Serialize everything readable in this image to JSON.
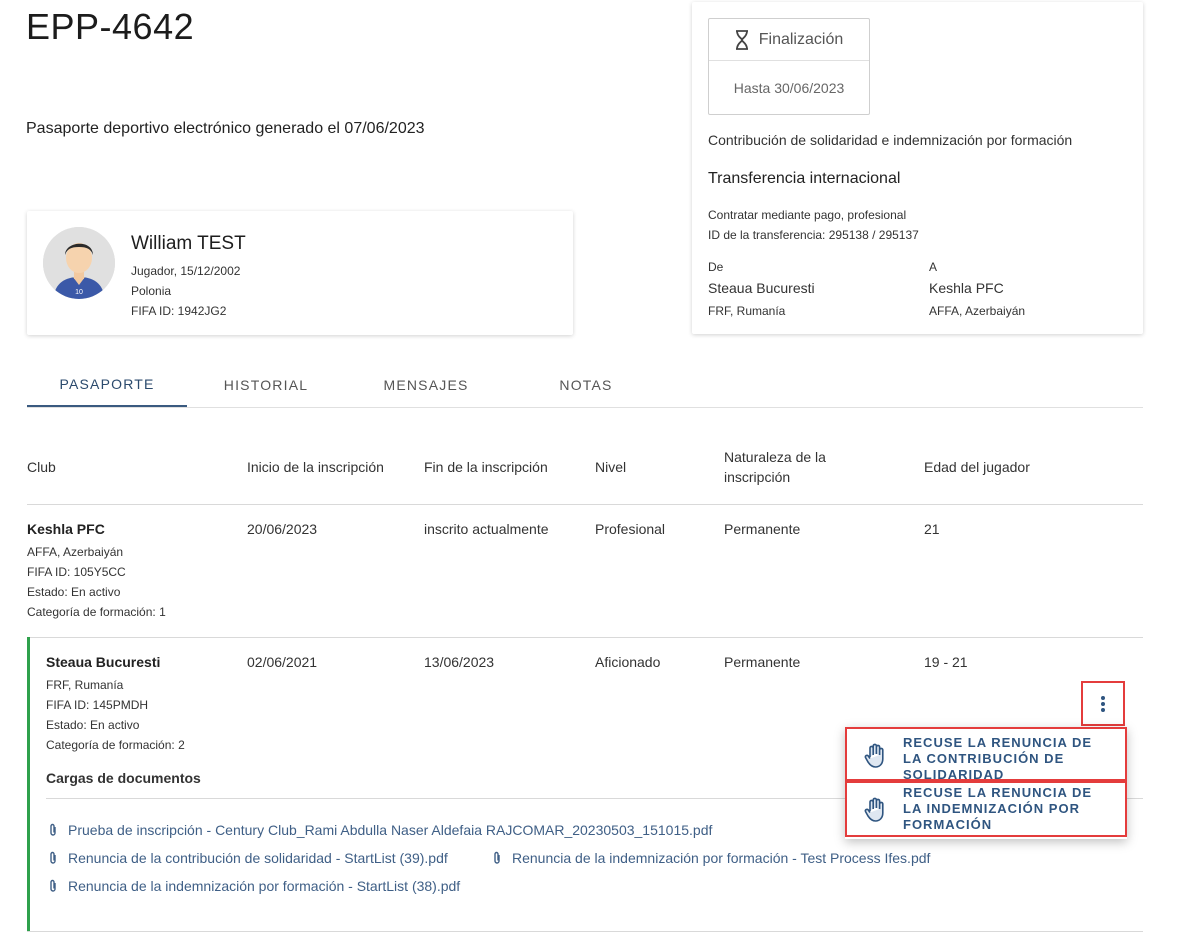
{
  "header": {
    "title": "EPP-4642",
    "subtitle": "Pasaporte deportivo electrónico generado el 07/06/2023"
  },
  "player": {
    "name": "William TEST",
    "line1": "Jugador, 15/12/2002",
    "line2": "Polonia",
    "line3": "FIFA ID: 1942JG2",
    "jersey_number": "10"
  },
  "transfer": {
    "status_label": "Finalización",
    "status_date": "Hasta 30/06/2023",
    "contribution_text": "Contribución de solidaridad e indemnización por formación",
    "type_title": "Transferencia internacional",
    "detail_line1": "Contratar mediante pago, profesional",
    "detail_line2": "ID de la transferencia: 295138 / 295137",
    "from_label": "De",
    "from_club": "Steaua Bucuresti",
    "from_assoc": "FRF, Rumanía",
    "to_label": "A",
    "to_club": "Keshla PFC",
    "to_assoc": "AFFA, Azerbaiyán"
  },
  "tabs": [
    {
      "label": "PASAPORTE",
      "active": true
    },
    {
      "label": "HISTORIAL",
      "active": false
    },
    {
      "label": "MENSAJES",
      "active": false
    },
    {
      "label": "NOTAS",
      "active": false
    }
  ],
  "table": {
    "headers": {
      "club": "Club",
      "start": "Inicio de la inscripción",
      "end": "Fin de la inscripción",
      "level": "Nivel",
      "nature_1": "Naturaleza de la",
      "nature_2": "inscripción",
      "age": "Edad del jugador"
    },
    "rows": [
      {
        "club": "Keshla PFC",
        "assoc": "AFFA, Azerbaiyán",
        "fifa_id": "FIFA ID: 105Y5CC",
        "status": "Estado: En activo",
        "category": "Categoría de formación: 1",
        "start": "20/06/2023",
        "end": "inscrito actualmente",
        "level": "Profesional",
        "nature": "Permanente",
        "age": "21"
      },
      {
        "club": "Steaua Bucuresti",
        "assoc": "FRF, Rumanía",
        "fifa_id": "FIFA ID: 145PMDH",
        "status": "Estado: En activo",
        "category": "Categoría de formación: 2",
        "start": "02/06/2021",
        "end": "13/06/2023",
        "level": "Aficionado",
        "nature": "Permanente",
        "age": "19 - 21",
        "documents_title": "Cargas de documentos",
        "documents": [
          "Prueba de inscripción - Century Club_Rami Abdulla Naser Aldefaia RAJCOMAR_20230503_151015.pdf",
          "Renuncia de la contribución de solidaridad - StartList (39).pdf",
          "Renuncia de la indemnización por formación - Test Process Ifes.pdf",
          "Renuncia de la indemnización por formación - StartList (38).pdf"
        ]
      }
    ]
  },
  "menu": {
    "item1_line1": "RECUSE LA RENUNCIA DE",
    "item1_line2": "LA CONTRIBUCIÓN DE",
    "item1_line3": "SOLIDARIDAD",
    "item2_line1": "RECUSE LA RENUNCIA DE",
    "item2_line2": "LA INDEMNIZACIÓN POR",
    "item2_line3": "FORMACIÓN"
  },
  "colors": {
    "accent": "#2f5580",
    "highlight_border": "#e43c3c",
    "active_row_bar": "#2fa14c"
  }
}
